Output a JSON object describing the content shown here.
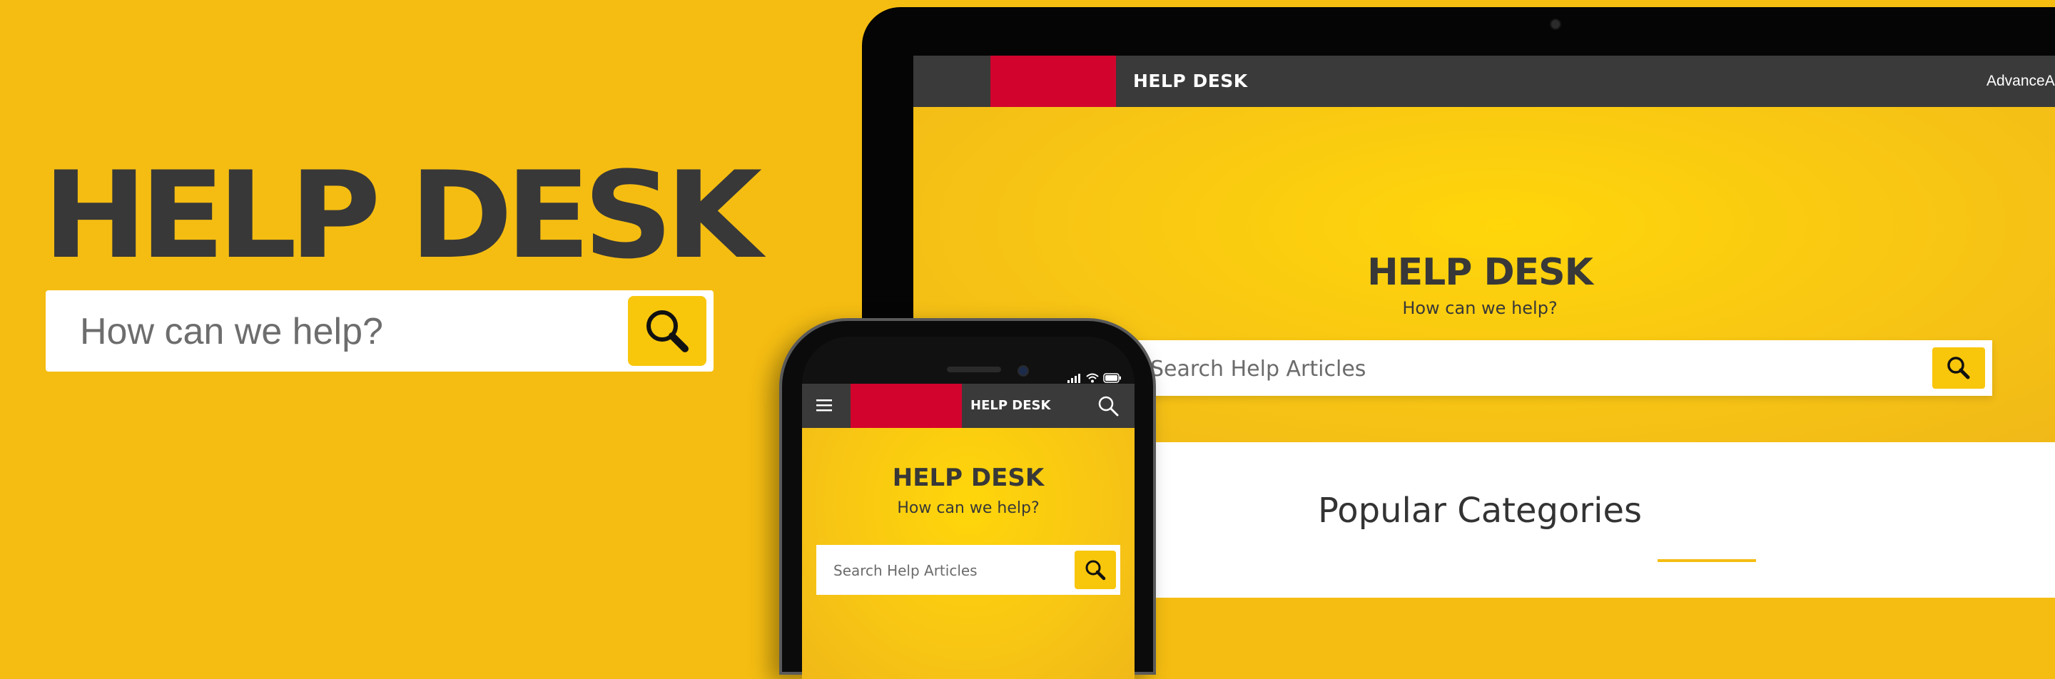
{
  "hero": {
    "title": "HELP DESK",
    "search_placeholder": "How can we help?"
  },
  "desktop": {
    "nav": {
      "title": "HELP DESK",
      "right_text": "AdvanceAu"
    },
    "hero": {
      "title": "HELP DESK",
      "subtitle": "How can we help?",
      "search_placeholder": "Search Help Articles"
    },
    "section_title": "Popular Categories"
  },
  "mobile": {
    "nav": {
      "title": "HELP DESK"
    },
    "hero": {
      "title": "HELP DESK",
      "subtitle": "How can we help?",
      "search_placeholder": "Search Help Articles"
    }
  },
  "colors": {
    "background": "#f5bd12",
    "accent_yellow": "#f8c60b",
    "brand_red": "#d2042d",
    "nav_dark": "#3a3a3a",
    "text_dark": "#383838"
  },
  "icons": {
    "search": "search-icon",
    "menu": "hamburger-menu-icon",
    "signal": "signal-icon",
    "wifi": "wifi-icon",
    "battery": "battery-icon"
  }
}
